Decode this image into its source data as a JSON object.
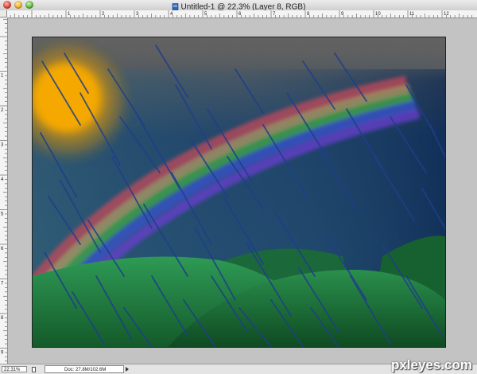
{
  "window": {
    "title": "Untitled-1 @ 22.3% (Layer 8, RGB)"
  },
  "rulers": {
    "top_labels": [
      "1",
      "2",
      "3",
      "4",
      "5",
      "6",
      "7",
      "8",
      "9",
      "10",
      "11",
      "12"
    ],
    "left_labels": [
      "1",
      "2",
      "3",
      "4",
      "5",
      "6",
      "7",
      "8",
      "9"
    ]
  },
  "status_bar": {
    "zoom": "22.31%",
    "doc_info": "Doc: 27.8M/102.6M"
  },
  "artwork": {
    "description_free": true,
    "colors": {
      "sky_top": "#5b5b5b",
      "sky_dark": "#0f2f5a",
      "sun": "#f2a300",
      "hill_green": "#1e7a3a",
      "rain": "#1e3f8a"
    }
  },
  "watermark": {
    "text": "pxleyes.com"
  }
}
